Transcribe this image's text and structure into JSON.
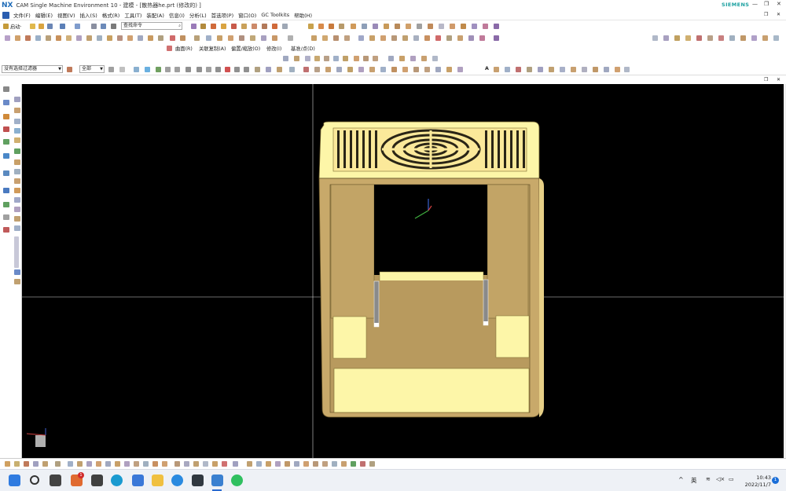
{
  "titlebar": {
    "logo": "NX",
    "title": "CAM Single Machine Environment 10 - 建模 - [散热器he.prt  (修改的)  ]",
    "brand": "SIEMENS",
    "minimize_icon": "minimize-icon",
    "restore_icon": "restore-icon",
    "close_icon": "close-icon"
  },
  "menubar": {
    "items": [
      "文件(F)",
      "编辑(E)",
      "视图(V)",
      "插入(S)",
      "格式(R)",
      "工具(T)",
      "装配(A)",
      "信息(I)",
      "分析(L)",
      "首选项(P)",
      "窗口(O)",
      "GC Toolkits",
      "帮助(H)"
    ]
  },
  "toolbar": {
    "start_label": "启动·",
    "search_placeholder": "查找命令",
    "group_labels": [
      "曲面(R)",
      "关联复制(A)",
      "偏置/缩放(O)",
      "修改(I)",
      "基准/点(D)"
    ]
  },
  "selection_bar": {
    "filter_value": "没有选择过滤器",
    "scope_value": "全部"
  },
  "taskbar": {
    "time": "10:43",
    "date": "2022/11/7",
    "ime": "英",
    "notify_badge": "1",
    "app_badge": "1"
  },
  "colors": {
    "part": "#fdf6a8",
    "part_shade": "#c8a96a",
    "part_dark": "#a78955",
    "brand": "#1aa0a0",
    "nx_blue": "#1e6bb8"
  }
}
